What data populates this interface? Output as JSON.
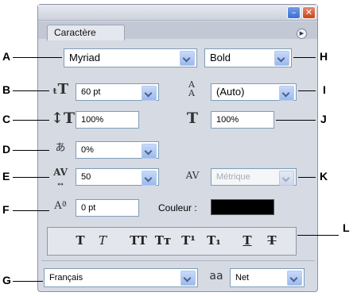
{
  "panel": {
    "tab_title": "Caractère",
    "font_family": "Myriad",
    "font_style": "Bold",
    "font_size": "60 pt",
    "leading": "(Auto)",
    "vertical_scale": "100%",
    "horizontal_scale": "100%",
    "tsume": "0%",
    "tracking": "50",
    "kerning": "Métrique",
    "baseline_shift": "0 pt",
    "color_label": "Couleur :",
    "color_value": "#000000",
    "language": "Français",
    "antialias_icon_text": "aa",
    "antialias": "Net"
  },
  "style_buttons": [
    {
      "name": "faux-bold",
      "glyph": "T"
    },
    {
      "name": "faux-italic",
      "glyph": "T"
    },
    {
      "name": "all-caps",
      "glyph": "TT"
    },
    {
      "name": "small-caps",
      "glyph": "Tт"
    },
    {
      "name": "superscript",
      "glyph": "T¹"
    },
    {
      "name": "subscript",
      "glyph": "T₁"
    },
    {
      "name": "underline",
      "glyph": "T"
    },
    {
      "name": "strikethrough",
      "glyph": "T"
    }
  ],
  "callouts": {
    "a": "A",
    "b": "B",
    "c": "C",
    "d": "D",
    "e": "E",
    "f": "F",
    "g": "G",
    "h": "H",
    "i": "I",
    "j": "J",
    "k": "K",
    "l": "L"
  }
}
